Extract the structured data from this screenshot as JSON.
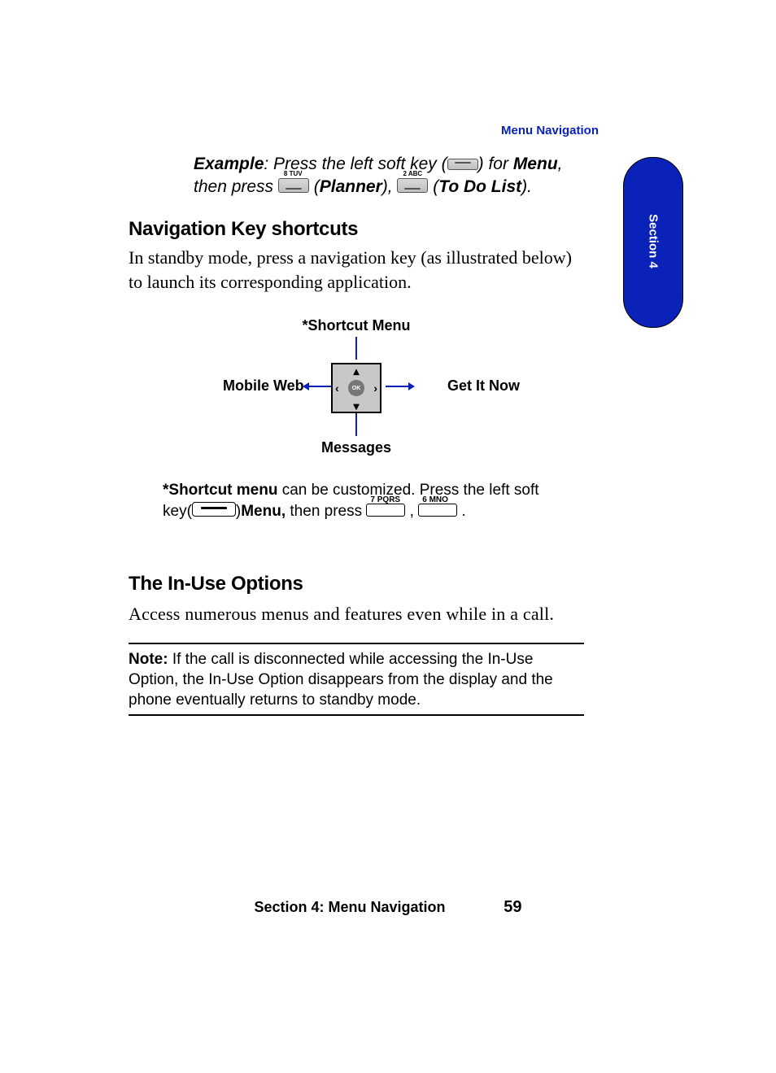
{
  "running_head": "Menu Navigation",
  "section_tab": "Section 4",
  "example": {
    "label": "Example",
    "part1": ": Press the left soft key (",
    "part2": ") for ",
    "menu": "Menu",
    "part3": ", then press ",
    "key1_label": "8 TUV",
    "planner_open": " (",
    "planner": "Planner",
    "planner_close": "), ",
    "key2_label": "2 ABC",
    "todo_open": " (",
    "todo": "To Do List",
    "todo_close": ")."
  },
  "heading_nav": "Navigation Key shortcuts",
  "para_nav": "In standby mode, press a navigation key (as illustrated below) to launch its corresponding application.",
  "diagram": {
    "top": "*Shortcut Menu",
    "left": "Mobile Web",
    "right": "Get It Now",
    "bottom": "Messages",
    "ok": "OK"
  },
  "sm_note": {
    "lead": "*Shortcut menu",
    "mid1": " can be customized.  Press the left soft key(",
    "menu": "Menu,",
    "mid2": "then press ",
    "k1": "7 PQRS",
    "comma": " , ",
    "k2": "6 MNO",
    "end": " ."
  },
  "heading_inuse": "The In-Use Options",
  "para_inuse": "Access numerous menus and features even while in a call.",
  "note": {
    "label": "Note:",
    "text": " If the call is disconnected while accessing the In-Use Option, the In-Use Option disappears from the display and the phone eventually returns to standby mode."
  },
  "footer": {
    "section": "Section 4: Menu Navigation",
    "page": "59"
  }
}
